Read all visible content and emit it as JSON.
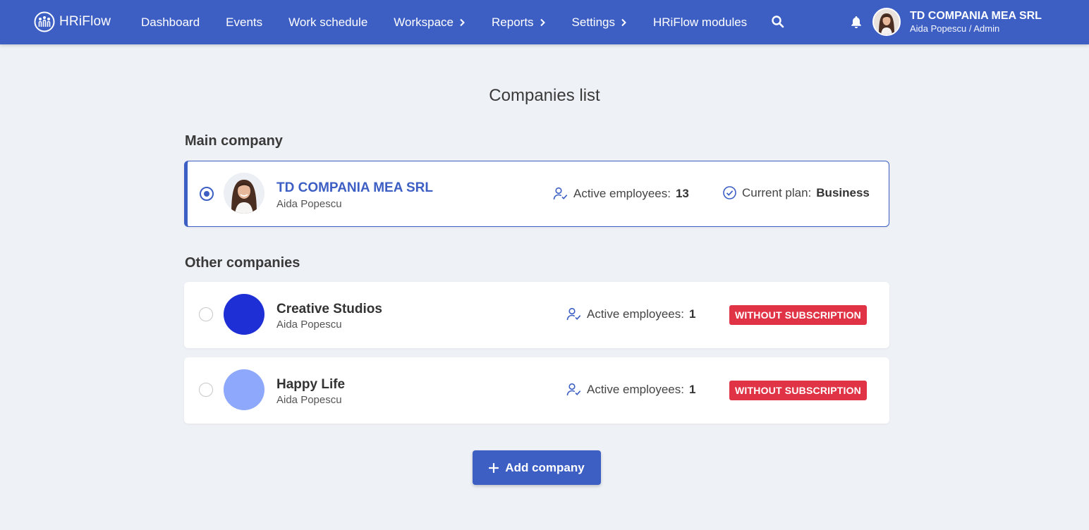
{
  "app": {
    "logo_text": "HRiFlow"
  },
  "nav": {
    "items": [
      {
        "label": "Dashboard",
        "has_chevron": false
      },
      {
        "label": "Events",
        "has_chevron": false
      },
      {
        "label": "Work schedule",
        "has_chevron": false
      },
      {
        "label": "Workspace",
        "has_chevron": true
      },
      {
        "label": "Reports",
        "has_chevron": true
      },
      {
        "label": "Settings",
        "has_chevron": true
      },
      {
        "label": "HRiFlow modules",
        "has_chevron": false
      }
    ],
    "search_icon": "search-icon",
    "bell_icon": "bell-icon"
  },
  "user": {
    "company": "TD COMPANIA MEA SRL",
    "role": "Aida Popescu / Admin"
  },
  "page": {
    "title": "Companies list",
    "main_section": "Main company",
    "other_section": "Other companies",
    "active_label": "Active employees:",
    "plan_label": "Current plan:",
    "add_button": "Add company"
  },
  "main_company": {
    "name": "TD COMPANIA MEA SRL",
    "owner": "Aida Popescu",
    "active_employees": "13",
    "plan": "Business"
  },
  "other_companies": [
    {
      "name": "Creative Studios",
      "owner": "Aida Popescu",
      "active_employees": "1",
      "badge": "WITHOUT SUBSCRIPTION",
      "color": "#1f2fd6"
    },
    {
      "name": "Happy Life",
      "owner": "Aida Popescu",
      "active_employees": "1",
      "badge": "WITHOUT SUBSCRIPTION",
      "color": "#8ea8fb"
    }
  ],
  "colors": {
    "primary": "#3d5fc4",
    "badge": "#e03345",
    "background": "#eef1f6"
  }
}
